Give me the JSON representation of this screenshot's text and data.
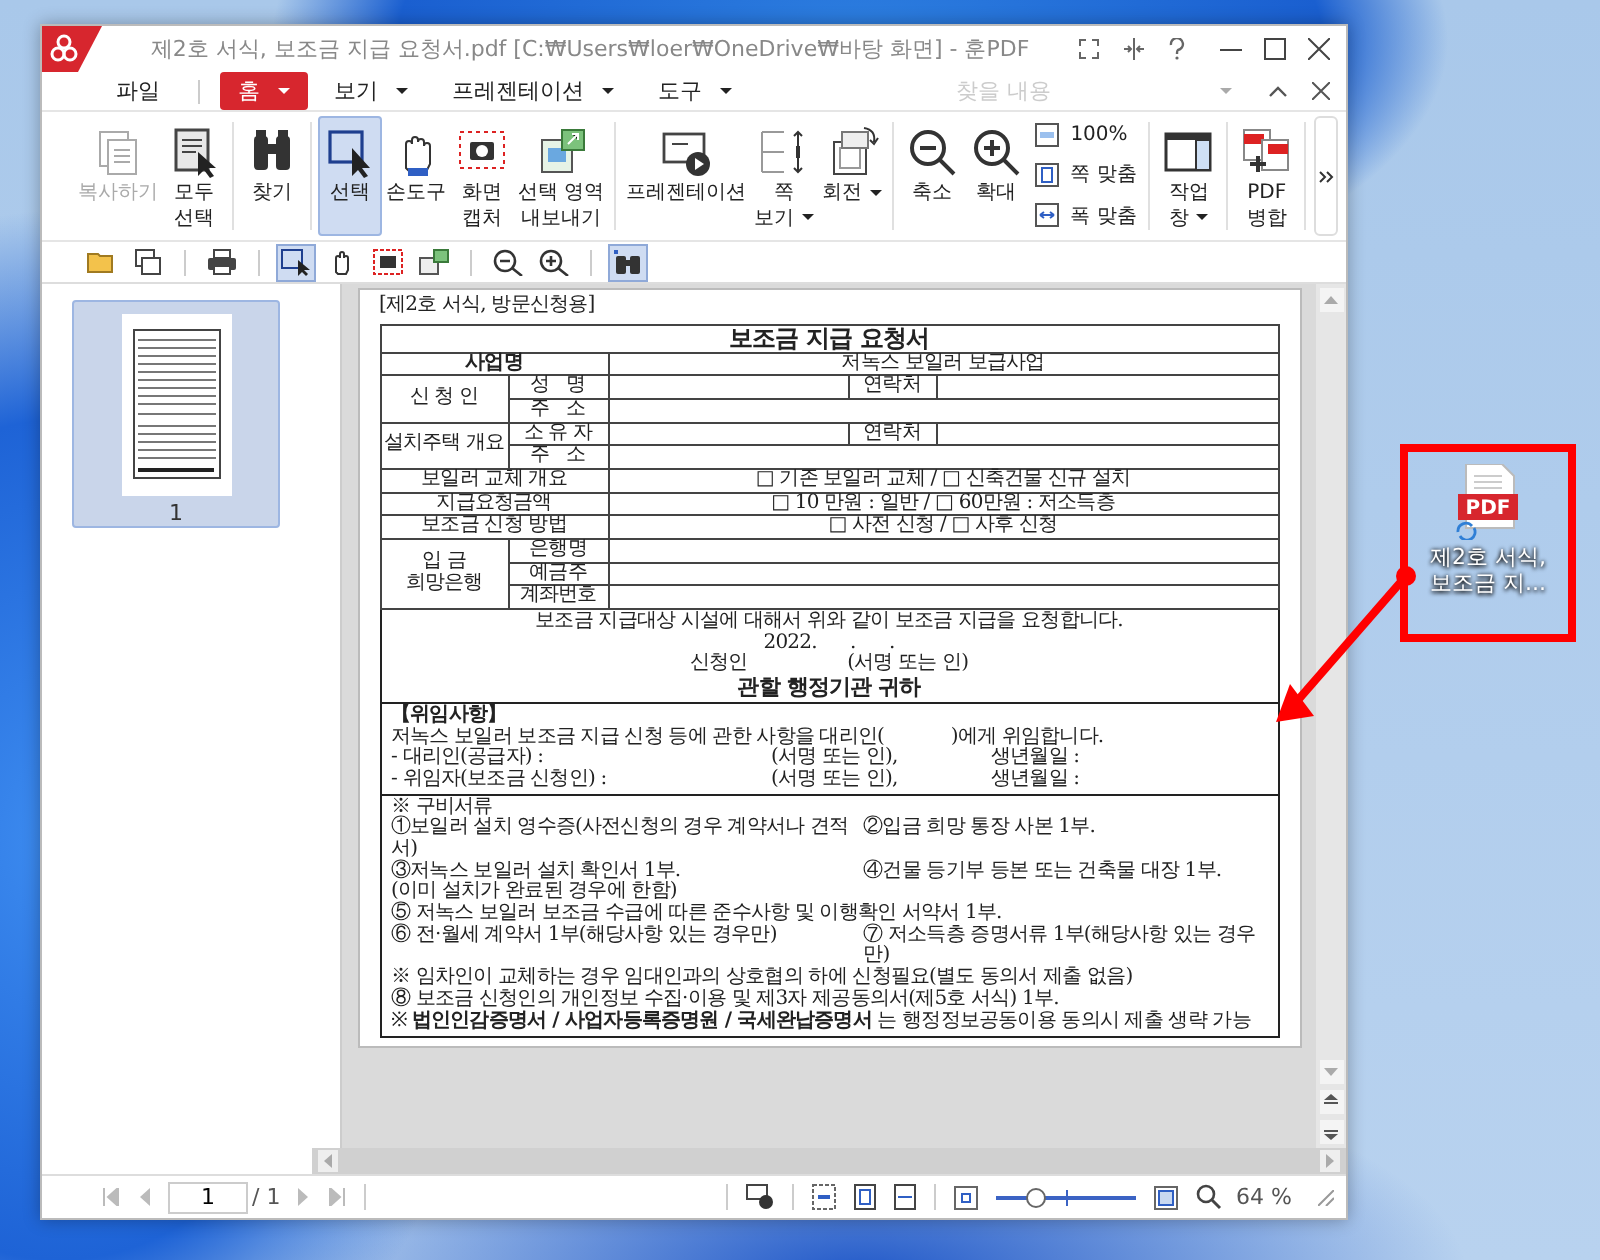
{
  "window": {
    "title": "제2호 서식, 보조금 지급 요청서.pdf [C:₩Users₩loer₩OneDrive₩바탕 화면] - 훈PDF"
  },
  "menu": [
    {
      "label": "파일",
      "selected": false,
      "dropdown": false
    },
    {
      "label": "홈",
      "selected": true,
      "dropdown": true
    },
    {
      "label": "보기",
      "selected": false,
      "dropdown": true
    },
    {
      "label": "프레젠테이션",
      "selected": false,
      "dropdown": true
    },
    {
      "label": "도구",
      "selected": false,
      "dropdown": true
    }
  ],
  "search": {
    "placeholder": "찾을 내용"
  },
  "ribbon": [
    [
      {
        "kind": "large",
        "label": "복사하기",
        "disabled": true,
        "selected": false,
        "dropdown": false
      },
      {
        "kind": "large",
        "label": "모두\n선택",
        "disabled": false,
        "selected": false,
        "dropdown": false
      }
    ],
    [
      {
        "kind": "large",
        "label": "찾기",
        "disabled": false,
        "selected": false,
        "dropdown": false
      }
    ],
    [
      {
        "kind": "large",
        "label": "선택",
        "disabled": false,
        "selected": true,
        "dropdown": false
      },
      {
        "kind": "large",
        "label": "손도구",
        "disabled": false,
        "selected": false,
        "dropdown": false
      },
      {
        "kind": "large",
        "label": "화면\n캡처",
        "disabled": false,
        "selected": false,
        "dropdown": false
      },
      {
        "kind": "large",
        "label": "선택 영역\n내보내기",
        "disabled": false,
        "selected": false,
        "dropdown": false
      }
    ],
    [
      {
        "kind": "large",
        "label": "프레젠테이션",
        "disabled": false,
        "selected": false,
        "dropdown": false
      },
      {
        "kind": "large",
        "label": "쪽\n보기",
        "disabled": false,
        "selected": false,
        "dropdown": true
      },
      {
        "kind": "large",
        "label": "회전",
        "disabled": false,
        "selected": false,
        "dropdown": true
      }
    ],
    [
      {
        "kind": "large",
        "label": "축소",
        "disabled": false,
        "selected": false,
        "dropdown": false
      },
      {
        "kind": "large",
        "label": "확대",
        "disabled": false,
        "selected": false,
        "dropdown": false
      },
      {
        "kind": "stack",
        "items": [
          "100%",
          "쪽 맞춤",
          "폭 맞춤"
        ]
      }
    ],
    [
      {
        "kind": "large",
        "label": "작업\n창",
        "disabled": false,
        "selected": false,
        "dropdown": true
      }
    ],
    [
      {
        "kind": "large",
        "label": "PDF\n병합",
        "disabled": false,
        "selected": false,
        "dropdown": false
      }
    ]
  ],
  "toolbar": [
    {
      "selected": false
    },
    {
      "selected": false
    },
    {
      "selected": false
    },
    {
      "selected": true
    },
    {
      "selected": false
    },
    {
      "selected": false
    },
    {
      "selected": false
    },
    {
      "selected": false
    },
    {
      "selected": false
    },
    {
      "selected": true
    }
  ],
  "thumbnails": [
    {
      "label": "1",
      "selected": true
    }
  ],
  "document": {
    "form_label": "[제2호 서식, 방문신청용]",
    "title": "보조금 지급 요청서",
    "rows": [
      {
        "kind": "heading_pair",
        "label": "사업명",
        "value": "저녹스 보일러 보급사업"
      },
      {
        "kind": "group",
        "label": "신 청 인",
        "rows": [
          {
            "label": "성   명",
            "contact": "연락처"
          },
          {
            "label": "주   소"
          }
        ]
      },
      {
        "kind": "group",
        "label": "설치주택 개요",
        "rows": [
          {
            "label": "소 유 자",
            "contact": "연락처"
          },
          {
            "label": "주   소"
          }
        ]
      },
      {
        "kind": "pair",
        "label": "보일러 교체 개요",
        "value": "□ 기존 보일러 교체 / □ 신축건물 신규 설치"
      },
      {
        "kind": "pair",
        "label": "지급요청금액",
        "value": "□ 10 만원 : 일반  / □ 60만원 : 저소득층"
      },
      {
        "kind": "pair",
        "label": "보조금 신청 방법",
        "value": "□ 사전 신청  / □ 사후 신청"
      },
      {
        "kind": "group",
        "label": "입 금 희망은행",
        "rows": [
          {
            "label": "은행명"
          },
          {
            "label": "예금주"
          },
          {
            "label": "계좌번호"
          }
        ]
      }
    ],
    "request": {
      "text": "보조금 지급대상 시설에 대해서 위와 같이 보조금 지급을 요청합니다.",
      "date": "2022.      .      .",
      "applicant": "신청인",
      "sign": "(서명 또는 인)",
      "addressee": "관할 행정기관 귀하"
    },
    "delegation": {
      "title": "【위임사항】",
      "text": "저녹스 보일러 보조금 지급 신청 등에 관한 사항을 대리인(            )에게 위임합니다.",
      "lines": [
        {
          "label": "- 대리인(공급자) :",
          "sign": "(서명 또는 인),",
          "birth": "생년월일 :"
        },
        {
          "label": "- 위임자(보조금 신청인) :",
          "sign": "(서명 또는 인),",
          "birth": "생년월일 :"
        }
      ]
    },
    "attachments": {
      "title": "※ 구비서류",
      "items": [
        {
          "kind": "half",
          "text": "①보일러 설치 영수증(사전신청의 경우 계약서나 견적서)"
        },
        {
          "kind": "half",
          "text": "②입금 희망 통장 사본 1부."
        },
        {
          "kind": "half",
          "text": "③저녹스 보일러 설치 확인서 1부."
        },
        {
          "kind": "half",
          "text": "④건물 등기부 등본 또는 건축물 대장 1부."
        },
        {
          "kind": "full",
          "text": "(이미 설치가 완료된 경우에 한함)"
        },
        {
          "kind": "full",
          "text": "⑤ 저녹스 보일러 보조금 수급에 따른 준수사항 및 이행확인 서약서 1부."
        },
        {
          "kind": "half",
          "text": "⑥ 전·월세 계약서 1부(해당사항 있는 경우만)"
        },
        {
          "kind": "half",
          "text": "⑦ 저소득층 증명서류 1부(해당사항 있는 경우만)"
        },
        {
          "kind": "full",
          "text": "※ 임차인이 교체하는 경우 임대인과의 상호협의 하에 신청필요(별도 동의서 제출 없음)"
        },
        {
          "kind": "full",
          "text": "⑧ 보조금 신청인의 개인정보 수집·이용 및 제3자 제공동의서(제5호 서식) 1부."
        },
        {
          "kind": "full",
          "text": "※ **법인인감증명서 / 사업자등록증명원 / 국세완납증명서** 는 행정정보공동이용 동의시 제출 생략 가능"
        }
      ]
    }
  },
  "pager": {
    "page": "1",
    "total": "/ 1"
  },
  "zoom": {
    "level": 0.28,
    "reading": "64 %"
  },
  "desktop_icon": {
    "badge": "PDF",
    "label": "제2호 서식, 보조금 지..."
  }
}
